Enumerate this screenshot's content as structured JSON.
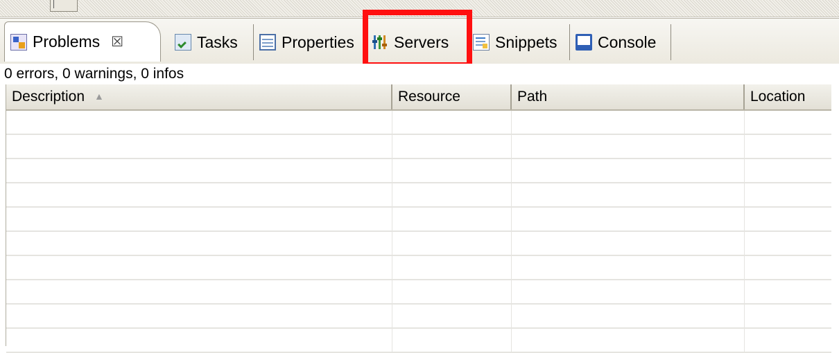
{
  "tabs": [
    {
      "label": "Problems",
      "icon": "problems-icon",
      "active": true,
      "closable": true
    },
    {
      "label": "Tasks",
      "icon": "tasks-icon"
    },
    {
      "label": "Properties",
      "icon": "properties-icon"
    },
    {
      "label": "Servers",
      "icon": "servers-icon",
      "highlighted": true
    },
    {
      "label": "Snippets",
      "icon": "snippets-icon"
    },
    {
      "label": "Console",
      "icon": "console-icon"
    }
  ],
  "close_glyph": "☒",
  "status": "0 errors, 0 warnings, 0 infos",
  "table": {
    "columns": [
      "Description",
      "Resource",
      "Path",
      "Location"
    ],
    "sort_column": "Description",
    "sort_glyph": "▲"
  },
  "colors": {
    "highlight": "#ff1010"
  }
}
